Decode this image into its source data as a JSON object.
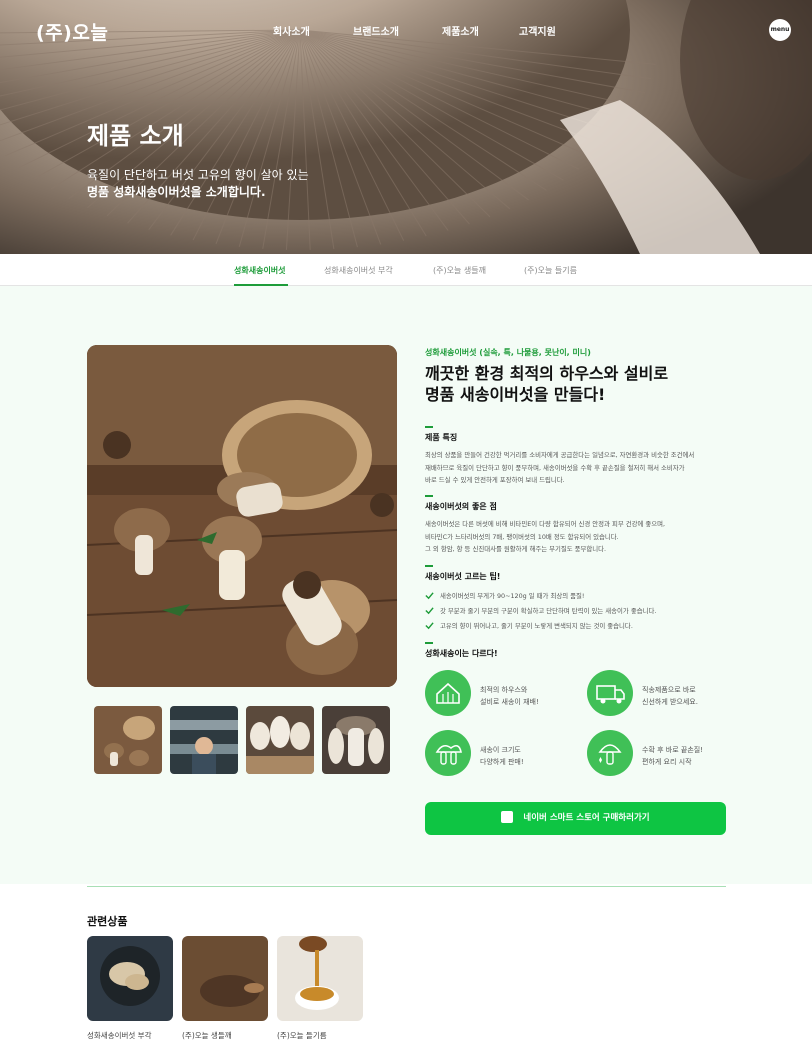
{
  "header": {
    "logo": "(주)오늘",
    "nav": [
      "회사소개",
      "브랜드소개",
      "제품소개",
      "고객지원"
    ],
    "menu_label": "menu"
  },
  "hero": {
    "title": "제품 소개",
    "subtitle_line1": "육질이 단단하고 버섯 고유의 향이 살아 있는",
    "subtitle_line2": "명품 성화새송이버섯을 소개합니다."
  },
  "tabs": [
    {
      "label": "성화새송이버섯",
      "active": true
    },
    {
      "label": "성화새송이버섯 부각",
      "active": false
    },
    {
      "label": "(주)오늘 생들깨",
      "active": false
    },
    {
      "label": "(주)오늘 들기름",
      "active": false
    }
  ],
  "product": {
    "category": "성화새송이버섯 (실속, 특, 나물용, 못난이, 미니)",
    "headline_line1": "깨끗한 환경 최적의 하우스와 설비로",
    "headline_line2": "명품 새송이버섯을 만들다!",
    "sections": [
      {
        "title": "제품 특징",
        "lines": [
          "최상의 상품을 만들어 건강한 먹거리를 소비자에게 공급한다는 일념으로, 자연환경과 비슷한 조건에서",
          "재배하므로 육질이 단단하고 향이 풍부하며, 새송이버섯을 수확 후 끝손질을 철저히 해서 소비자가",
          "바로 드실 수 있게 안전하게 포장하여 보내 드립니다."
        ]
      },
      {
        "title": "새송이버섯의 좋은 점",
        "lines": [
          "새송이버섯은 다른 버섯에 비해 비타민E이 다량 함유되어 신경 안정과 피부 건강에 좋으며,",
          "비타민C가 느타리버섯의 7배, 팽이버섯의 10배 정도 함유되어 있습니다.",
          "그 외 항암, 항 등 신진대사를 원활하게 해주는 무기질도 풍부합니다."
        ]
      }
    ],
    "tips_title": "새송이버섯 고르는 팁!",
    "tips": [
      "새송이버섯의 무게가 90~120g 일 때가 최상의 품질!",
      "갓 부분과 줄기 부분의 구분이 확실하고 단단하며 탄력이 있는 새송이가 좋습니다.",
      "고유의 향이 뛰어나고, 줄기 부분이 노랗게 변색되지 않는 것이 좋습니다."
    ],
    "diff_title": "성화새송이는 다르다!",
    "features": [
      {
        "icon": "greenhouse-icon",
        "line1": "최적의 하우스와",
        "line2": "설비로 새송이 재배!"
      },
      {
        "icon": "delivery-truck-icon",
        "line1": "직송제품으로 바로",
        "line2": "신선하게 받으세요."
      },
      {
        "icon": "mushroom-cluster-icon",
        "line1": "새송이 크기도",
        "line2": "다양하게 판매!"
      },
      {
        "icon": "mushroom-sparkle-icon",
        "line1": "수확 후 바로 끝손질!",
        "line2": "편하게 요리 시작"
      }
    ],
    "buy_button": "네이버 스마트 스토어 구매하러가기"
  },
  "related": {
    "title": "관련상품",
    "items": [
      {
        "label": "성화새송이버섯 부각"
      },
      {
        "label": "(주)오늘 생들깨"
      },
      {
        "label": "(주)오늘 들기름"
      }
    ]
  },
  "colors": {
    "accent": "#1e9c3a",
    "button": "#0ec543",
    "icon_circle": "#40c057",
    "section_bg": "#f4fcf6"
  }
}
